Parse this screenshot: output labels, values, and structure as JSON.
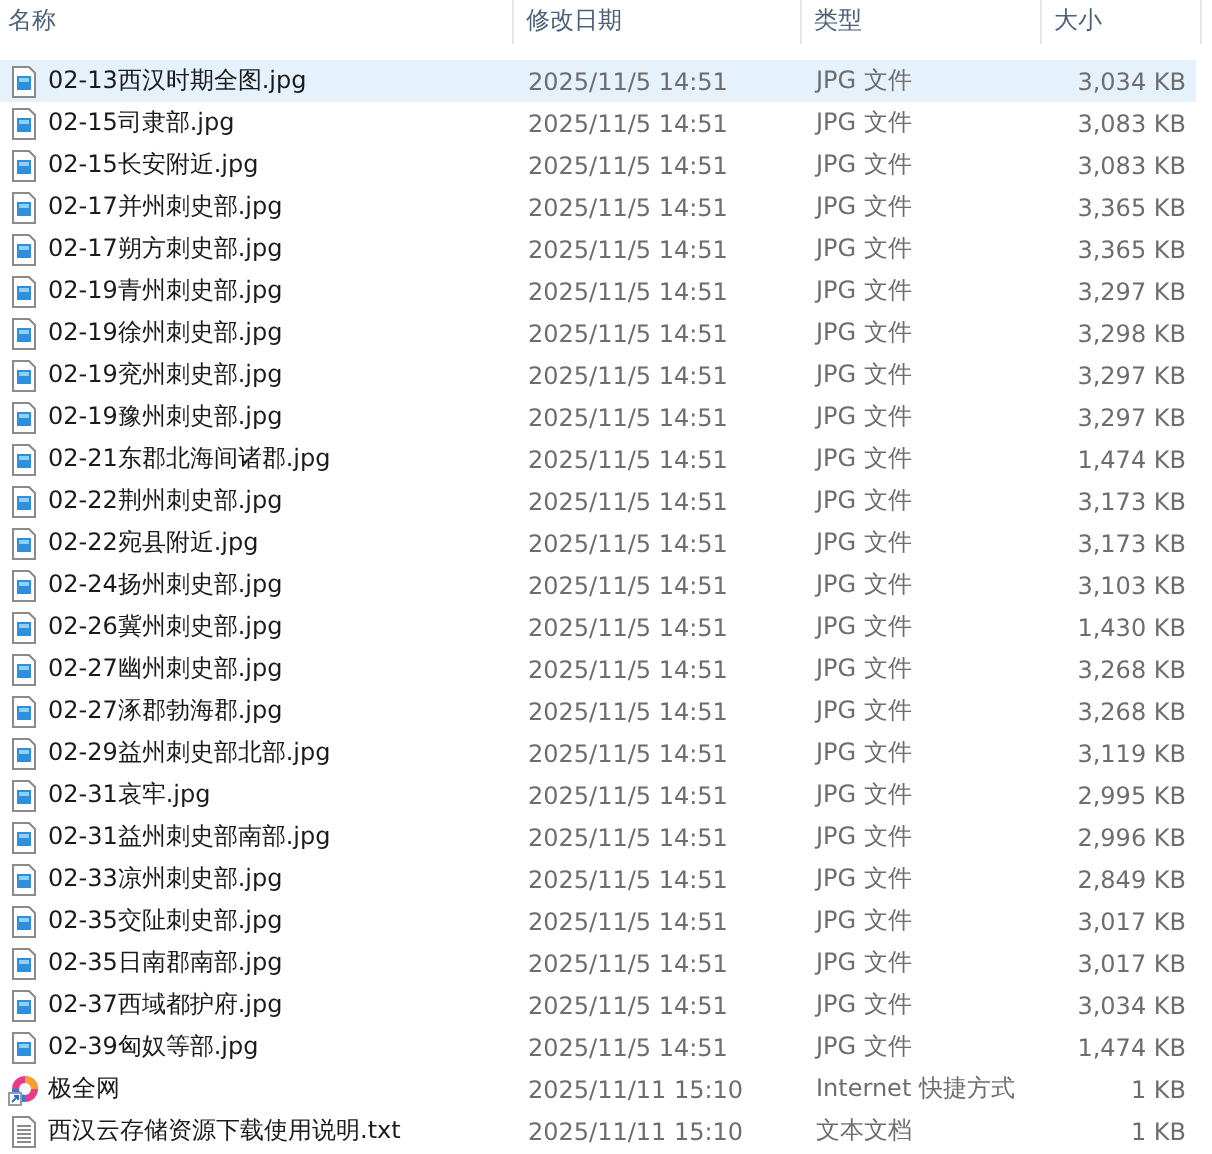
{
  "columns": [
    "名称",
    "修改日期",
    "类型",
    "大小"
  ],
  "rows": [
    {
      "kind": "image",
      "name": "02-13西汉时期全图.jpg",
      "date": "2025/11/5 14:51",
      "type": "JPG 文件",
      "size": "3,034 KB",
      "selected": true
    },
    {
      "kind": "image",
      "name": "02-15司隶部.jpg",
      "date": "2025/11/5 14:51",
      "type": "JPG 文件",
      "size": "3,083 KB",
      "selected": false
    },
    {
      "kind": "image",
      "name": "02-15长安附近.jpg",
      "date": "2025/11/5 14:51",
      "type": "JPG 文件",
      "size": "3,083 KB",
      "selected": false
    },
    {
      "kind": "image",
      "name": "02-17并州刺史部.jpg",
      "date": "2025/11/5 14:51",
      "type": "JPG 文件",
      "size": "3,365 KB",
      "selected": false
    },
    {
      "kind": "image",
      "name": "02-17朔方刺史部.jpg",
      "date": "2025/11/5 14:51",
      "type": "JPG 文件",
      "size": "3,365 KB",
      "selected": false
    },
    {
      "kind": "image",
      "name": "02-19青州刺史部.jpg",
      "date": "2025/11/5 14:51",
      "type": "JPG 文件",
      "size": "3,297 KB",
      "selected": false
    },
    {
      "kind": "image",
      "name": "02-19徐州刺史部.jpg",
      "date": "2025/11/5 14:51",
      "type": "JPG 文件",
      "size": "3,298 KB",
      "selected": false
    },
    {
      "kind": "image",
      "name": "02-19兖州刺史部.jpg",
      "date": "2025/11/5 14:51",
      "type": "JPG 文件",
      "size": "3,297 KB",
      "selected": false
    },
    {
      "kind": "image",
      "name": "02-19豫州刺史部.jpg",
      "date": "2025/11/5 14:51",
      "type": "JPG 文件",
      "size": "3,297 KB",
      "selected": false
    },
    {
      "kind": "image",
      "name": "02-21东郡北海间诸郡.jpg",
      "date": "2025/11/5 14:51",
      "type": "JPG 文件",
      "size": "1,474 KB",
      "selected": false
    },
    {
      "kind": "image",
      "name": "02-22荆州刺史部.jpg",
      "date": "2025/11/5 14:51",
      "type": "JPG 文件",
      "size": "3,173 KB",
      "selected": false
    },
    {
      "kind": "image",
      "name": "02-22宛县附近.jpg",
      "date": "2025/11/5 14:51",
      "type": "JPG 文件",
      "size": "3,173 KB",
      "selected": false
    },
    {
      "kind": "image",
      "name": "02-24扬州刺史部.jpg",
      "date": "2025/11/5 14:51",
      "type": "JPG 文件",
      "size": "3,103 KB",
      "selected": false
    },
    {
      "kind": "image",
      "name": "02-26冀州刺史部.jpg",
      "date": "2025/11/5 14:51",
      "type": "JPG 文件",
      "size": "1,430 KB",
      "selected": false
    },
    {
      "kind": "image",
      "name": "02-27幽州刺史部.jpg",
      "date": "2025/11/5 14:51",
      "type": "JPG 文件",
      "size": "3,268 KB",
      "selected": false
    },
    {
      "kind": "image",
      "name": "02-27涿郡勃海郡.jpg",
      "date": "2025/11/5 14:51",
      "type": "JPG 文件",
      "size": "3,268 KB",
      "selected": false
    },
    {
      "kind": "image",
      "name": "02-29益州刺史部北部.jpg",
      "date": "2025/11/5 14:51",
      "type": "JPG 文件",
      "size": "3,119 KB",
      "selected": false
    },
    {
      "kind": "image",
      "name": "02-31哀牢.jpg",
      "date": "2025/11/5 14:51",
      "type": "JPG 文件",
      "size": "2,995 KB",
      "selected": false
    },
    {
      "kind": "image",
      "name": "02-31益州刺史部南部.jpg",
      "date": "2025/11/5 14:51",
      "type": "JPG 文件",
      "size": "2,996 KB",
      "selected": false
    },
    {
      "kind": "image",
      "name": "02-33凉州刺史部.jpg",
      "date": "2025/11/5 14:51",
      "type": "JPG 文件",
      "size": "2,849 KB",
      "selected": false
    },
    {
      "kind": "image",
      "name": "02-35交阯刺史部.jpg",
      "date": "2025/11/5 14:51",
      "type": "JPG 文件",
      "size": "3,017 KB",
      "selected": false
    },
    {
      "kind": "image",
      "name": "02-35日南郡南部.jpg",
      "date": "2025/11/5 14:51",
      "type": "JPG 文件",
      "size": "3,017 KB",
      "selected": false
    },
    {
      "kind": "image",
      "name": "02-37西域都护府.jpg",
      "date": "2025/11/5 14:51",
      "type": "JPG 文件",
      "size": "3,034 KB",
      "selected": false
    },
    {
      "kind": "image",
      "name": "02-39匈奴等部.jpg",
      "date": "2025/11/5 14:51",
      "type": "JPG 文件",
      "size": "1,474 KB",
      "selected": false
    },
    {
      "kind": "shortcut",
      "name": "极全网",
      "date": "2025/11/11 15:10",
      "type": "Internet 快捷方式",
      "size": "1 KB",
      "selected": false
    },
    {
      "kind": "text",
      "name": "西汉云存储资源下载使用说明.txt",
      "date": "2025/11/11 15:10",
      "type": "文本文档",
      "size": "1 KB",
      "selected": false
    }
  ]
}
